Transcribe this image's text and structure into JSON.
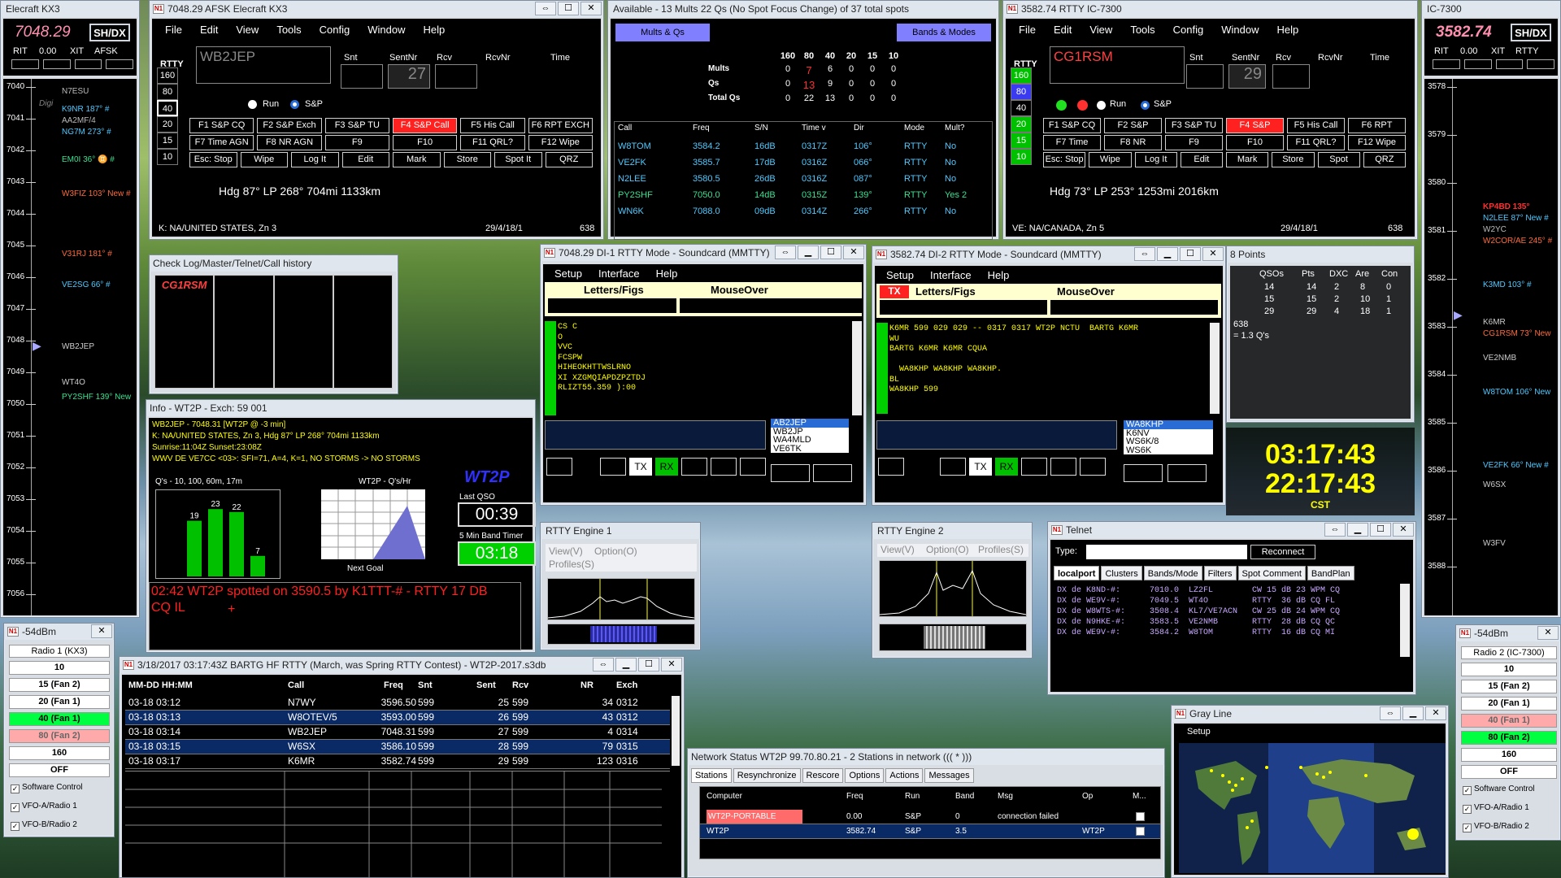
{
  "kx3": {
    "title": "Elecraft KX3",
    "freq": "7048.29",
    "shdx": "SH/DX",
    "rit_label": "RIT",
    "rit_val": "0.00",
    "xit_label": "XIT",
    "mode": "AFSK",
    "scale": [
      "7040",
      "7041",
      "7042",
      "7043",
      "7044",
      "7045",
      "7046",
      "7047",
      "7048",
      "7049",
      "7050",
      "7051",
      "7052",
      "7053",
      "7054",
      "7055",
      "7056"
    ],
    "spots": [
      "N7ESU",
      "Digi",
      "K9NR 187° #",
      "AA2MF/4",
      "NG7M 273° #",
      "EM0I 36° ♊ #",
      "W3FIZ 103° New #",
      "V31RJ 181° #",
      "VE2SG 66° #",
      "WB2JEP",
      "WT4O",
      "PY2SHF 139° New"
    ]
  },
  "ic7300": {
    "title": "IC-7300",
    "freq": "3582.74",
    "shdx": "SH/DX",
    "rit_label": "RIT",
    "rit_val": "0.00",
    "xit_label": "XIT",
    "mode": "RTTY",
    "scale": [
      "3578",
      "3579",
      "3580",
      "3581",
      "3582",
      "3583",
      "3584",
      "3585",
      "3586",
      "3587",
      "3588"
    ],
    "spots": [
      "KP4BD 135°",
      "N2LEE 87° New #",
      "W2YC",
      "W2COR/AE 245° #",
      "K3MD 103° #",
      "K6MR",
      "CG1RSM 73° New",
      "VE2NMB",
      "W8TOM 106° New",
      "VE2FK 66° New #",
      "W6SX",
      "W3FV"
    ]
  },
  "entry1": {
    "title": "7048.29 AFSK Elecraft KX3",
    "menu": [
      "File",
      "Edit",
      "View",
      "Tools",
      "Config",
      "Window",
      "Help"
    ],
    "mode": "RTTY",
    "call": "WB2JEP",
    "snt": "Snt",
    "sentnr": "SentNr",
    "sentnr_val": "27",
    "rcv": "Rcv",
    "rcvnr": "RcvNr",
    "time": "Time",
    "bands": [
      "160",
      "80",
      "40",
      "20",
      "15",
      "10"
    ],
    "run": "Run",
    "sp": "S&P",
    "fkeys": [
      [
        "F1 S&P CQ",
        "F2 S&P Exch",
        "F3 S&P TU",
        "F4 S&P Call",
        "F5 His Call",
        "F6 RPT EXCH"
      ],
      [
        "F7 Time AGN",
        "F8 NR AGN",
        "F9",
        "F10",
        "F11 QRL?",
        "F12 Wipe"
      ],
      [
        "Esc: Stop",
        "Wipe",
        "Log It",
        "Edit",
        "Mark",
        "Store",
        "Spot It",
        "QRZ"
      ]
    ],
    "hdg": "Hdg  87°  LP 268°  704mi  1133km",
    "status": "K: NA/UNITED STATES, Zn 3",
    "date": "29/4/18/1",
    "num": "638"
  },
  "entry2": {
    "title": "3582.74 RTTY IC-7300",
    "menu": [
      "File",
      "Edit",
      "View",
      "Tools",
      "Config",
      "Window",
      "Help"
    ],
    "mode": "RTTY",
    "call": "CG1RSM",
    "snt": "Snt",
    "sentnr": "SentNr",
    "sentnr_val": "29",
    "rcv": "Rcv",
    "rcvnr": "RcvNr",
    "time": "Time",
    "bands": [
      "160",
      "80",
      "40",
      "20",
      "15",
      "10"
    ],
    "run": "Run",
    "sp": "S&P",
    "fkeys": [
      [
        "F1 S&P CQ",
        "F2 S&P",
        "F3 S&P TU",
        "F4 S&P",
        "F5 His Call",
        "F6 RPT"
      ],
      [
        "F7 Time",
        "F8 NR",
        "F9",
        "F10",
        "F11 QRL?",
        "F12 Wipe"
      ],
      [
        "Esc: Stop",
        "Wipe",
        "Log It",
        "Edit",
        "Mark",
        "Store",
        "Spot",
        "QRZ"
      ]
    ],
    "hdg": "Hdg  73°  LP 253°  1253mi  2016km",
    "status": "VE: NA/CANADA, Zn 5",
    "date": "29/4/18/1",
    "num": "638"
  },
  "avail": {
    "title": "Available - 13 Mults 22 Qs  (No Spot Focus Change) of 37 total spots",
    "btn1": "Mults & Qs",
    "btn2": "Bands & Modes",
    "bands": [
      "160",
      "80",
      "40",
      "20",
      "15",
      "10"
    ],
    "rows": [
      {
        "label": "Mults",
        "vals": [
          "0",
          "7",
          "6",
          "0",
          "0",
          "0"
        ]
      },
      {
        "label": "Qs",
        "vals": [
          "0",
          "13",
          "9",
          "0",
          "0",
          "0"
        ]
      },
      {
        "label": "Total Qs",
        "vals": [
          "0",
          "22",
          "13",
          "0",
          "0",
          "0"
        ]
      }
    ],
    "cols": [
      "Call",
      "Freq",
      "S/N",
      "Time v",
      "Dir",
      "Mode",
      "Mult?"
    ],
    "spots": [
      [
        "W8TOM",
        "3584.2",
        "16dB",
        "0317Z",
        "106°",
        "RTTY",
        "No"
      ],
      [
        "VE2FK",
        "3585.7",
        "17dB",
        "0316Z",
        "066°",
        "RTTY",
        "No"
      ],
      [
        "N2LEE",
        "3580.5",
        "26dB",
        "0316Z",
        "087°",
        "RTTY",
        "No"
      ],
      [
        "PY2SHF",
        "7050.0",
        "14dB",
        "0315Z",
        "139°",
        "RTTY",
        "Yes 2"
      ],
      [
        "WN6K",
        "7088.0",
        "09dB",
        "0314Z",
        "266°",
        "RTTY",
        "No"
      ]
    ]
  },
  "checklog": {
    "title": "Check Log/Master/Telnet/Call history",
    "call": "CG1RSM"
  },
  "info": {
    "title": "Info - WT2P - Exch: 59 001",
    "l1": "WB2JEP - 7048.31 [WT2P @ -3 min]",
    "l2": "K: NA/UNITED STATES, Zn 3, Hdg  87°  LP 268°  704mi  1133km",
    "l3": "Sunrise:11:04Z Sunset:23:08Z",
    "l4": "WWV DE VE7CC <03>:  SFI=71, A=4, K=1, NO STORMS -> NO STORMS",
    "chart_title": "Q's - 10, 100, 60m, 17m",
    "bars": [
      19,
      23,
      22,
      7
    ],
    "rate_title": "WT2P - Q's/Hr",
    "next_goal": "Next Goal",
    "station": "WT2P",
    "last_qso": "Last QSO",
    "last_val": "00:39",
    "band_timer": "5 Min Band Timer",
    "band_val": "03:18",
    "spotted": "02:42 WT2P spotted on 3590.5 by K1TTT-# - RTTY  17 DB",
    "spotted2": "CQ IL",
    "plus": "+"
  },
  "mmtty1": {
    "title": "7048.29 DI-1 RTTY Mode - Soundcard (MMTTY)",
    "menu": [
      "Setup",
      "Interface",
      "Help"
    ],
    "lf": "Letters/Figs",
    "mo": "MouseOver",
    "rx": [
      "CS C",
      "O",
      "VVC",
      "FCSPW",
      "HIHEOKHTTWSLRNO",
      "XI XZGMQIAPDZPZTDJ",
      "RLIZT55.359 ):00"
    ],
    "calls": [
      "AB2JEP",
      "WB2JP",
      "WA4MLD",
      "VE6TK"
    ],
    "tx": "TX",
    "rxb": "RX"
  },
  "mmtty2": {
    "title": "3582.74 DI-2 RTTY Mode - Soundcard (MMTTY)",
    "menu": [
      "Setup",
      "Interface",
      "Help"
    ],
    "lf": "Letters/Figs",
    "mo": "MouseOver",
    "txflag": "TX",
    "rx": [
      "K6MR 599 029 029 -- 0317 0317 WT2P NCTU  BARTG K6MR",
      "WU",
      "BARTG K6MR K6MR CQUA",
      "",
      "  WA8KHP WA8KHP WA8KHP.",
      "BL",
      "WA8KHP 599"
    ],
    "calls": [
      "WA8KHP",
      "K6NV",
      "WS6K/8",
      "WS6K"
    ],
    "tx": "TX",
    "rxb": "RX"
  },
  "engine1": {
    "title": "RTTY Engine 1",
    "m1": "View(V)",
    "m2": "Option(O)",
    "m3": "Profiles(S)"
  },
  "engine2": {
    "title": "RTTY Engine 2",
    "m1": "View(V)",
    "m2": "Option(O)",
    "m3": "Profiles(S)"
  },
  "score": {
    "title": "8 Points",
    "cols": [
      "QSOs",
      "Pts",
      "DXC",
      "Are",
      "Con"
    ],
    "rows": [
      [
        "14",
        "14",
        "2",
        "8",
        "0"
      ],
      [
        "15",
        "15",
        "2",
        "10",
        "1"
      ],
      [
        "29",
        "29",
        "4",
        "18",
        "1"
      ]
    ],
    "extra1": "638",
    "extra2": "= 1.3 Q's"
  },
  "clock": {
    "t1": "03:17:43",
    "t2": "22:17:43",
    "tz": "CST"
  },
  "telnet": {
    "title": "Telnet",
    "type_label": "Type:",
    "reconnect": "Reconnect",
    "tabs": [
      "localport",
      "Clusters",
      "Bands/Mode",
      "Filters",
      "Spot Comment",
      "BandPlan"
    ],
    "lines": [
      "DX de K8ND-#:      7010.0  LZ2FL        CW 15 dB 23 WPM CQ",
      "DX de WE9V-#:      7049.5  WT4O         RTTY  36 dB CQ FL",
      "DX de W8WTS-#:     3508.4  KL7/VE7ACN   CW 25 dB 24 WPM CQ",
      "DX de N9HKE-#:     3583.5  VE2NMB       RTTY  28 dB CQ QC",
      "DX de WE9V-#:      3584.2  W8TOM        RTTY  16 dB CQ MI"
    ]
  },
  "log": {
    "title": "3/18/2017 03:17:43Z  BARTG HF RTTY (March, was Spring RTTY Contest) - WT2P-2017.s3db",
    "cols": [
      "MM-DD HH:MM",
      "Call",
      "Freq",
      "Snt",
      "Sent",
      "Rcv",
      "NR",
      "Exch"
    ],
    "rows": [
      [
        "03-18 03:12",
        "N7WY",
        "3596.50",
        "599",
        "25",
        "599",
        "34",
        "0312"
      ],
      [
        "03-18 03:13",
        "W8OTEV/5",
        "3593.00",
        "599",
        "26",
        "599",
        "43",
        "0312"
      ],
      [
        "03-18 03:14",
        "WB2JEP",
        "7048.31",
        "599",
        "27",
        "599",
        "4",
        "0314"
      ],
      [
        "03-18 03:15",
        "W6SX",
        "3586.10",
        "599",
        "28",
        "599",
        "79",
        "0315"
      ],
      [
        "03-18 03:17",
        "K6MR",
        "3582.74",
        "599",
        "29",
        "599",
        "123",
        "0316"
      ]
    ]
  },
  "network": {
    "title": "Network Status WT2P 99.70.80.21 - 2 Stations in network  ((( * )))",
    "tabs": [
      "Stations",
      "Resynchronize",
      "Rescore",
      "Options",
      "Actions",
      "Messages"
    ],
    "cols": [
      "Computer",
      "Freq",
      "Run",
      "Band",
      "Msg",
      "Op",
      "M..."
    ],
    "rows": [
      [
        "WT2P-PORTABLE",
        "0.00",
        "S&P",
        "0",
        "connection failed",
        ""
      ],
      [
        "WT2P",
        "3582.74",
        "S&P",
        "3.5",
        "",
        "WT2P"
      ]
    ]
  },
  "grayline": {
    "title": "Gray Line",
    "setup": "Setup"
  },
  "radio1": {
    "title": "-54dBm",
    "label": "Radio 1 (KX3)",
    "btns": [
      "10",
      "15 (Fan 2)",
      "20 (Fan 1)",
      "40 (Fan 1)",
      "80 (Fan 2)",
      "160",
      "OFF"
    ],
    "chk": [
      "Software Control",
      "VFO-A/Radio 1",
      "VFO-B/Radio 2"
    ]
  },
  "radio2": {
    "title": "-54dBm",
    "label": "Radio 2 (IC-7300)",
    "btns": [
      "10",
      "15 (Fan 2)",
      "20 (Fan 1)",
      "40 (Fan 1)",
      "80 (Fan 2)",
      "160",
      "OFF"
    ],
    "chk": [
      "Software Control",
      "VFO-A/Radio 1",
      "VFO-B/Radio 2"
    ]
  },
  "colors": {
    "accent_red": "#ff2020",
    "green": "#00d000",
    "yellow": "#ffff00",
    "highlight": "#0a2a66"
  }
}
